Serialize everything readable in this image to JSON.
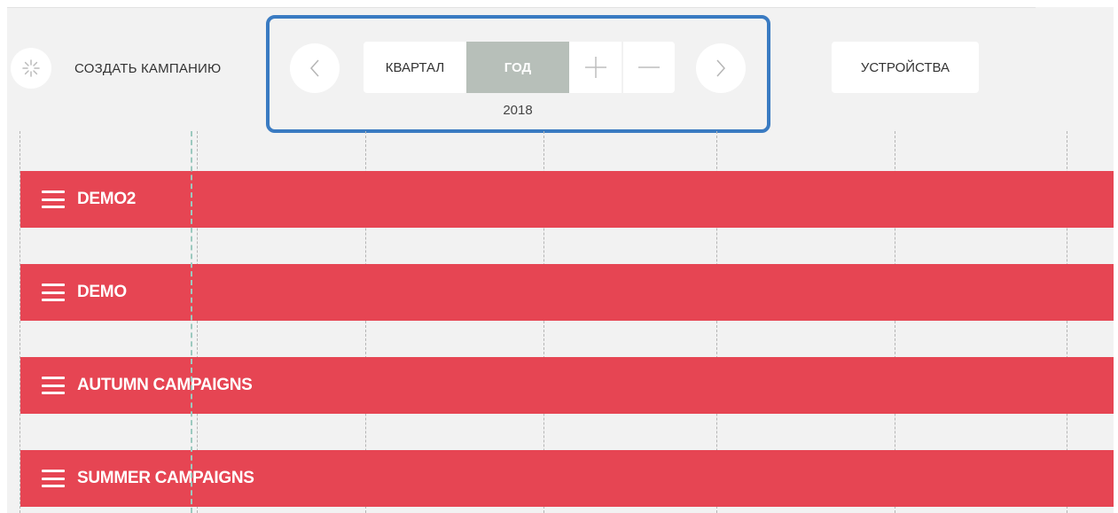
{
  "toolbar": {
    "create_campaign_label": "СОЗДАТЬ КАМПАНИЮ",
    "period_options": [
      "КВАРТАЛ",
      "ГОД"
    ],
    "selected_period": "ГОД",
    "zoom_in_symbol": "+",
    "zoom_out_symbol": "—",
    "year": "2018",
    "devices_label": "УСТРОЙСТВА"
  },
  "icons": {
    "create": "spinner-icon",
    "prev": "chevron-left-icon",
    "next": "chevron-right-icon",
    "row_handle": "hamburger-icon"
  },
  "campaigns": [
    {
      "name": "DEMO2"
    },
    {
      "name": "DEMO"
    },
    {
      "name": "AUTUMN CAMPAIGNS"
    },
    {
      "name": "SUMMER CAMPAIGNS"
    }
  ],
  "colors": {
    "campaign_bar": "#e64553",
    "selected_segment": "#b7bfb9",
    "highlight": "#3a7bc2",
    "today_line": "#9cc9bf",
    "background": "#f2f2f2"
  }
}
